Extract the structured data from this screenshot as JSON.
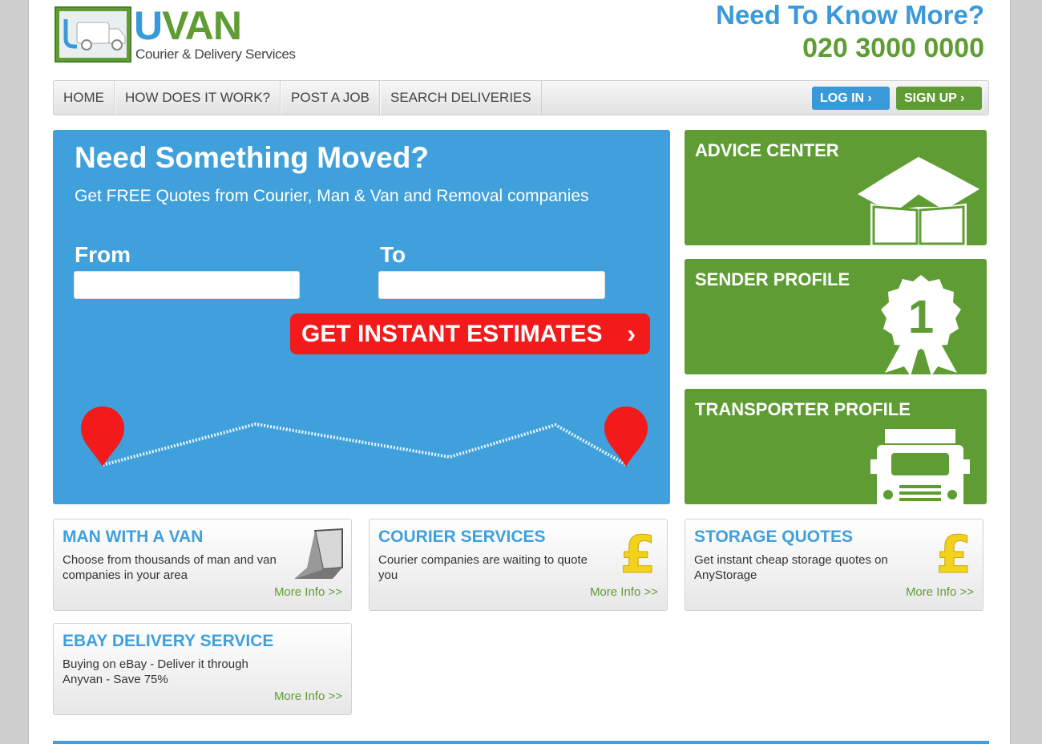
{
  "header": {
    "logo_prefix": "U",
    "logo_rest": "VAN",
    "tagline": "Courier & Delivery Services",
    "contact_title": "Need To Know More?",
    "phone": "020 3000 0000"
  },
  "nav": {
    "items": [
      {
        "label": "HOME"
      },
      {
        "label": "HOW DOES IT WORK?"
      },
      {
        "label": "POST A JOB"
      },
      {
        "label": "SEARCH DELIVERIES"
      }
    ],
    "login_label": "LOG IN ›",
    "signup_label": "SIGN UP ›"
  },
  "hero": {
    "title": "Need Something Moved?",
    "subtitle": "Get FREE Quotes from Courier, Man & Van and Removal companies",
    "from_label": "From",
    "to_label": "To",
    "from_value": "",
    "to_value": "",
    "cta_label": "GET INSTANT ESTIMATES",
    "cta_chevron": "›"
  },
  "tiles": [
    {
      "title": "ADVICE CENTER",
      "icon": "open-box-icon"
    },
    {
      "title": "SENDER PROFILE",
      "icon": "award-badge-icon",
      "badge_number": "1"
    },
    {
      "title": "TRANSPORTER PROFILE",
      "icon": "truck-icon"
    }
  ],
  "cards": [
    {
      "title": "MAN WITH A VAN",
      "text": "Choose from thousands of man and van companies in your area",
      "more": "More Info >>",
      "icon": "laptop-icon"
    },
    {
      "title": "COURIER SERVICES",
      "text": "Courier companies are waiting to quote you",
      "more": "More Info >>",
      "icon": "pound-icon"
    },
    {
      "title": "STORAGE QUOTES",
      "text": "Get instant cheap storage quotes on AnyStorage",
      "more": "More Info >>",
      "icon": "pound-icon"
    },
    {
      "title": "EBAY DELIVERY SERVICE",
      "text": "Buying on eBay - Deliver it through Anyvan - Save 75%",
      "more": "More Info >>"
    }
  ],
  "colors": {
    "blue": "#3fa0dc",
    "green": "#5f9d34",
    "red": "#f21a1a"
  }
}
